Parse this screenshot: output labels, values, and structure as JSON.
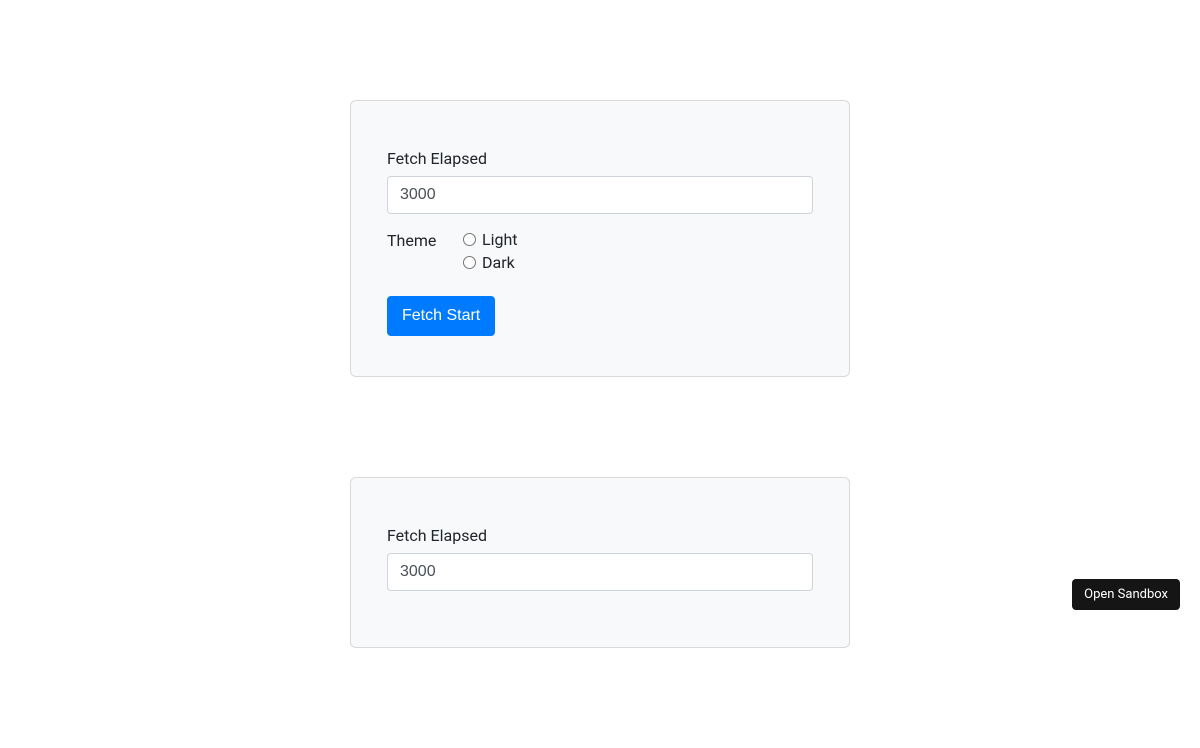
{
  "card1": {
    "fetch_elapsed_label": "Fetch Elapsed",
    "fetch_elapsed_value": "3000",
    "theme_label": "Theme",
    "radio_options": {
      "light": "Light",
      "dark": "Dark"
    },
    "submit_label": "Fetch Start"
  },
  "card2": {
    "fetch_elapsed_label": "Fetch Elapsed",
    "fetch_elapsed_value": "3000"
  },
  "sandbox_button_label": "Open Sandbox"
}
